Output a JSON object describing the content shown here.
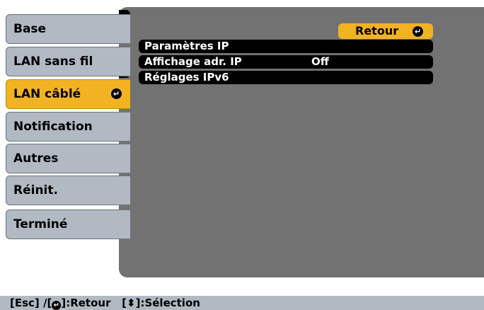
{
  "sidebar": {
    "items": [
      {
        "label": "Base"
      },
      {
        "label": "LAN sans fil"
      },
      {
        "label": "LAN câblé"
      },
      {
        "label": "Notification"
      },
      {
        "label": "Autres"
      },
      {
        "label": "Réinit."
      },
      {
        "label": "Terminé"
      }
    ],
    "active_index": 2
  },
  "main": {
    "retour_label": "Retour",
    "rows": [
      {
        "label": "Paramètres IP",
        "value": ""
      },
      {
        "label": "Affichage adr. IP",
        "value": "Off"
      },
      {
        "label": "Réglages IPv6",
        "value": ""
      }
    ]
  },
  "help_bar": {
    "esc": "[Esc] /[",
    "retour": "]:Retour",
    "sel_open": "[",
    "sel": "]:Sélection"
  },
  "icons": {
    "return": "return-icon",
    "updown": "up-down-arrow-icon"
  },
  "colors": {
    "accent": "#f2b322",
    "tab": "#b1b9c3",
    "panel": "#727272",
    "row": "#000000"
  }
}
